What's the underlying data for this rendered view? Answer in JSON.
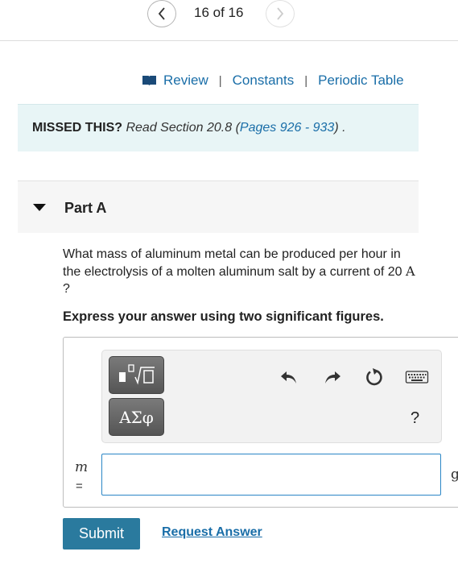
{
  "pager": {
    "position_text": "16 of 16"
  },
  "links": {
    "review": "Review",
    "constants": "Constants",
    "periodic_table": "Periodic Table",
    "separator": "|"
  },
  "missed": {
    "label": "MISSED THIS?",
    "read_text": "Read Section 20.8",
    "open_paren": "(",
    "pages": "Pages 926 - 933",
    "close": ") ."
  },
  "part": {
    "title": "Part A"
  },
  "question": {
    "text_before": "What mass of aluminum metal can be produced per hour in the electrolysis of a molten aluminum salt by a current of 20",
    "unit": "A",
    "text_after": "?"
  },
  "instruction": "Express your answer using two significant figures.",
  "toolbar": {
    "symbols_label": "ΑΣφ",
    "help_label": "?",
    "icons": [
      "templates-icon",
      "undo-icon",
      "redo-icon",
      "reset-icon",
      "keyboard-icon"
    ]
  },
  "answer": {
    "variable": "m",
    "equals": "=",
    "value": "",
    "unit": "g"
  },
  "actions": {
    "submit": "Submit",
    "request_answer": "Request Answer"
  },
  "colors": {
    "link": "#1a6ea8",
    "submit_bg": "#2a7a9e",
    "missed_bg": "#e8f5f6",
    "input_border": "#2b86c6"
  }
}
